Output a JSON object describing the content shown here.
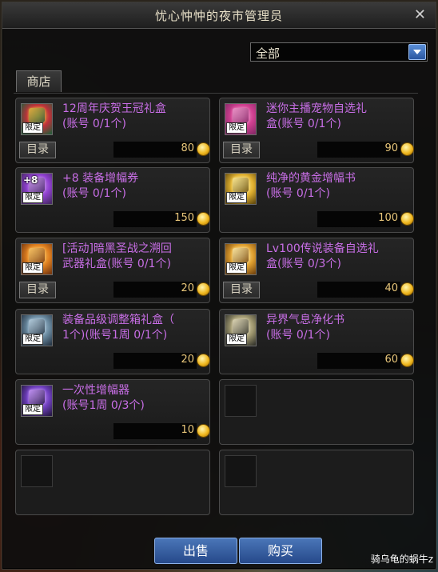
{
  "window": {
    "title": "忧心忡忡的夜市管理员",
    "close_icon": "close-icon"
  },
  "filter": {
    "selected": "全部"
  },
  "tabs": [
    {
      "label": "商店"
    }
  ],
  "items": [
    {
      "name": "12周年庆贺王冠礼盒\n(账号 0/1个)",
      "price": "80",
      "limited": "限定",
      "catalog": "目录",
      "icon": "crown-gift-icon",
      "colors": [
        "#2e5a3a",
        "#c0303a",
        "#e8c040"
      ]
    },
    {
      "name": "迷你主播宠物自选礼\n盒(账号 0/1个)",
      "price": "90",
      "limited": "限定",
      "catalog": "目录",
      "icon": "pet-gift-box-icon",
      "colors": [
        "#8a2a6a",
        "#d04090",
        "#f0a0d0"
      ]
    },
    {
      "name": "+8 装备增幅券\n(账号 0/1个)",
      "price": "150",
      "limited": "限定",
      "catalog": "",
      "badge": "+8",
      "icon": "amplify-ticket-icon",
      "colors": [
        "#4a2a6a",
        "#9040d0",
        "#d0a0f0"
      ]
    },
    {
      "name": "纯净的黄金增幅书\n(账号 0/1个)",
      "price": "100",
      "limited": "限定",
      "catalog": "",
      "icon": "golden-book-icon",
      "colors": [
        "#6a5010",
        "#e0b030",
        "#fff0a0"
      ]
    },
    {
      "name": "[活动]暗黑圣战之溯回\n武器礼盒(账号 0/1个)",
      "price": "20",
      "limited": "限定",
      "catalog": "目录",
      "icon": "weapon-gift-box-icon",
      "colors": [
        "#7a3a10",
        "#e08020",
        "#ffd070"
      ]
    },
    {
      "name": "Lv100传说装备自选礼\n盒(账号 0/3个)",
      "price": "40",
      "limited": "限定",
      "catalog": "目录",
      "icon": "legendary-box-icon",
      "colors": [
        "#7a4a10",
        "#e0a030",
        "#fff0b0"
      ]
    },
    {
      "name": "装备品级调整箱礼盒（\n1个)(账号1周 0/1个)",
      "price": "20",
      "limited": "限定",
      "catalog": "",
      "icon": "grade-box-icon",
      "colors": [
        "#2a3a4a",
        "#6a8aa0",
        "#c0d8e8"
      ]
    },
    {
      "name": "异界气息净化书\n(账号 0/1个)",
      "price": "60",
      "limited": "限定",
      "catalog": "",
      "icon": "purify-book-icon",
      "colors": [
        "#3a3a30",
        "#a09870",
        "#e8e0c0"
      ]
    },
    {
      "name": "一次性增幅器\n(账号1周 0/3个)",
      "price": "10",
      "limited": "限定",
      "catalog": "",
      "icon": "amplifier-icon",
      "colors": [
        "#2a1a4a",
        "#7040c0",
        "#d0a0ff"
      ]
    }
  ],
  "buttons": {
    "sell": "出售",
    "buy": "购买"
  },
  "watermark": "骑乌龟的蜗牛z"
}
